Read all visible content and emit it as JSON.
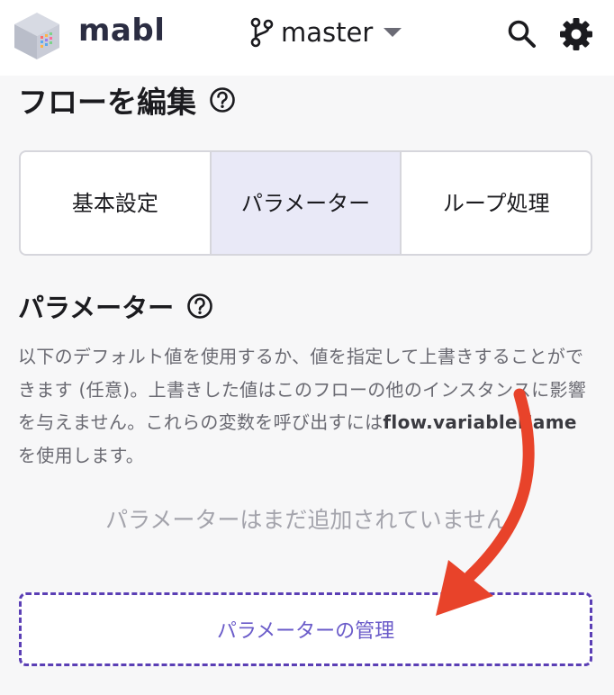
{
  "header": {
    "brand": "mabl",
    "branch": "master"
  },
  "page": {
    "title": "フローを編集"
  },
  "tabs": [
    {
      "label": "基本設定",
      "active": false
    },
    {
      "label": "パラメーター",
      "active": true
    },
    {
      "label": "ループ処理",
      "active": false
    }
  ],
  "parameters": {
    "title": "パラメーター",
    "description_pre": "以下のデフォルト値を使用するか、値を指定して上書きすることができます (任意)。上書きした値はこのフローの他のインスタンスに影響を与えません。これらの変数を呼び出すには",
    "description_code": "flow.variableName",
    "description_post": "を使用します。",
    "empty_text": "パラメーターはまだ追加されていません",
    "manage_label": "パラメーターの管理"
  },
  "colors": {
    "accent": "#5b3fb5",
    "annotation_arrow": "#e8432a"
  }
}
